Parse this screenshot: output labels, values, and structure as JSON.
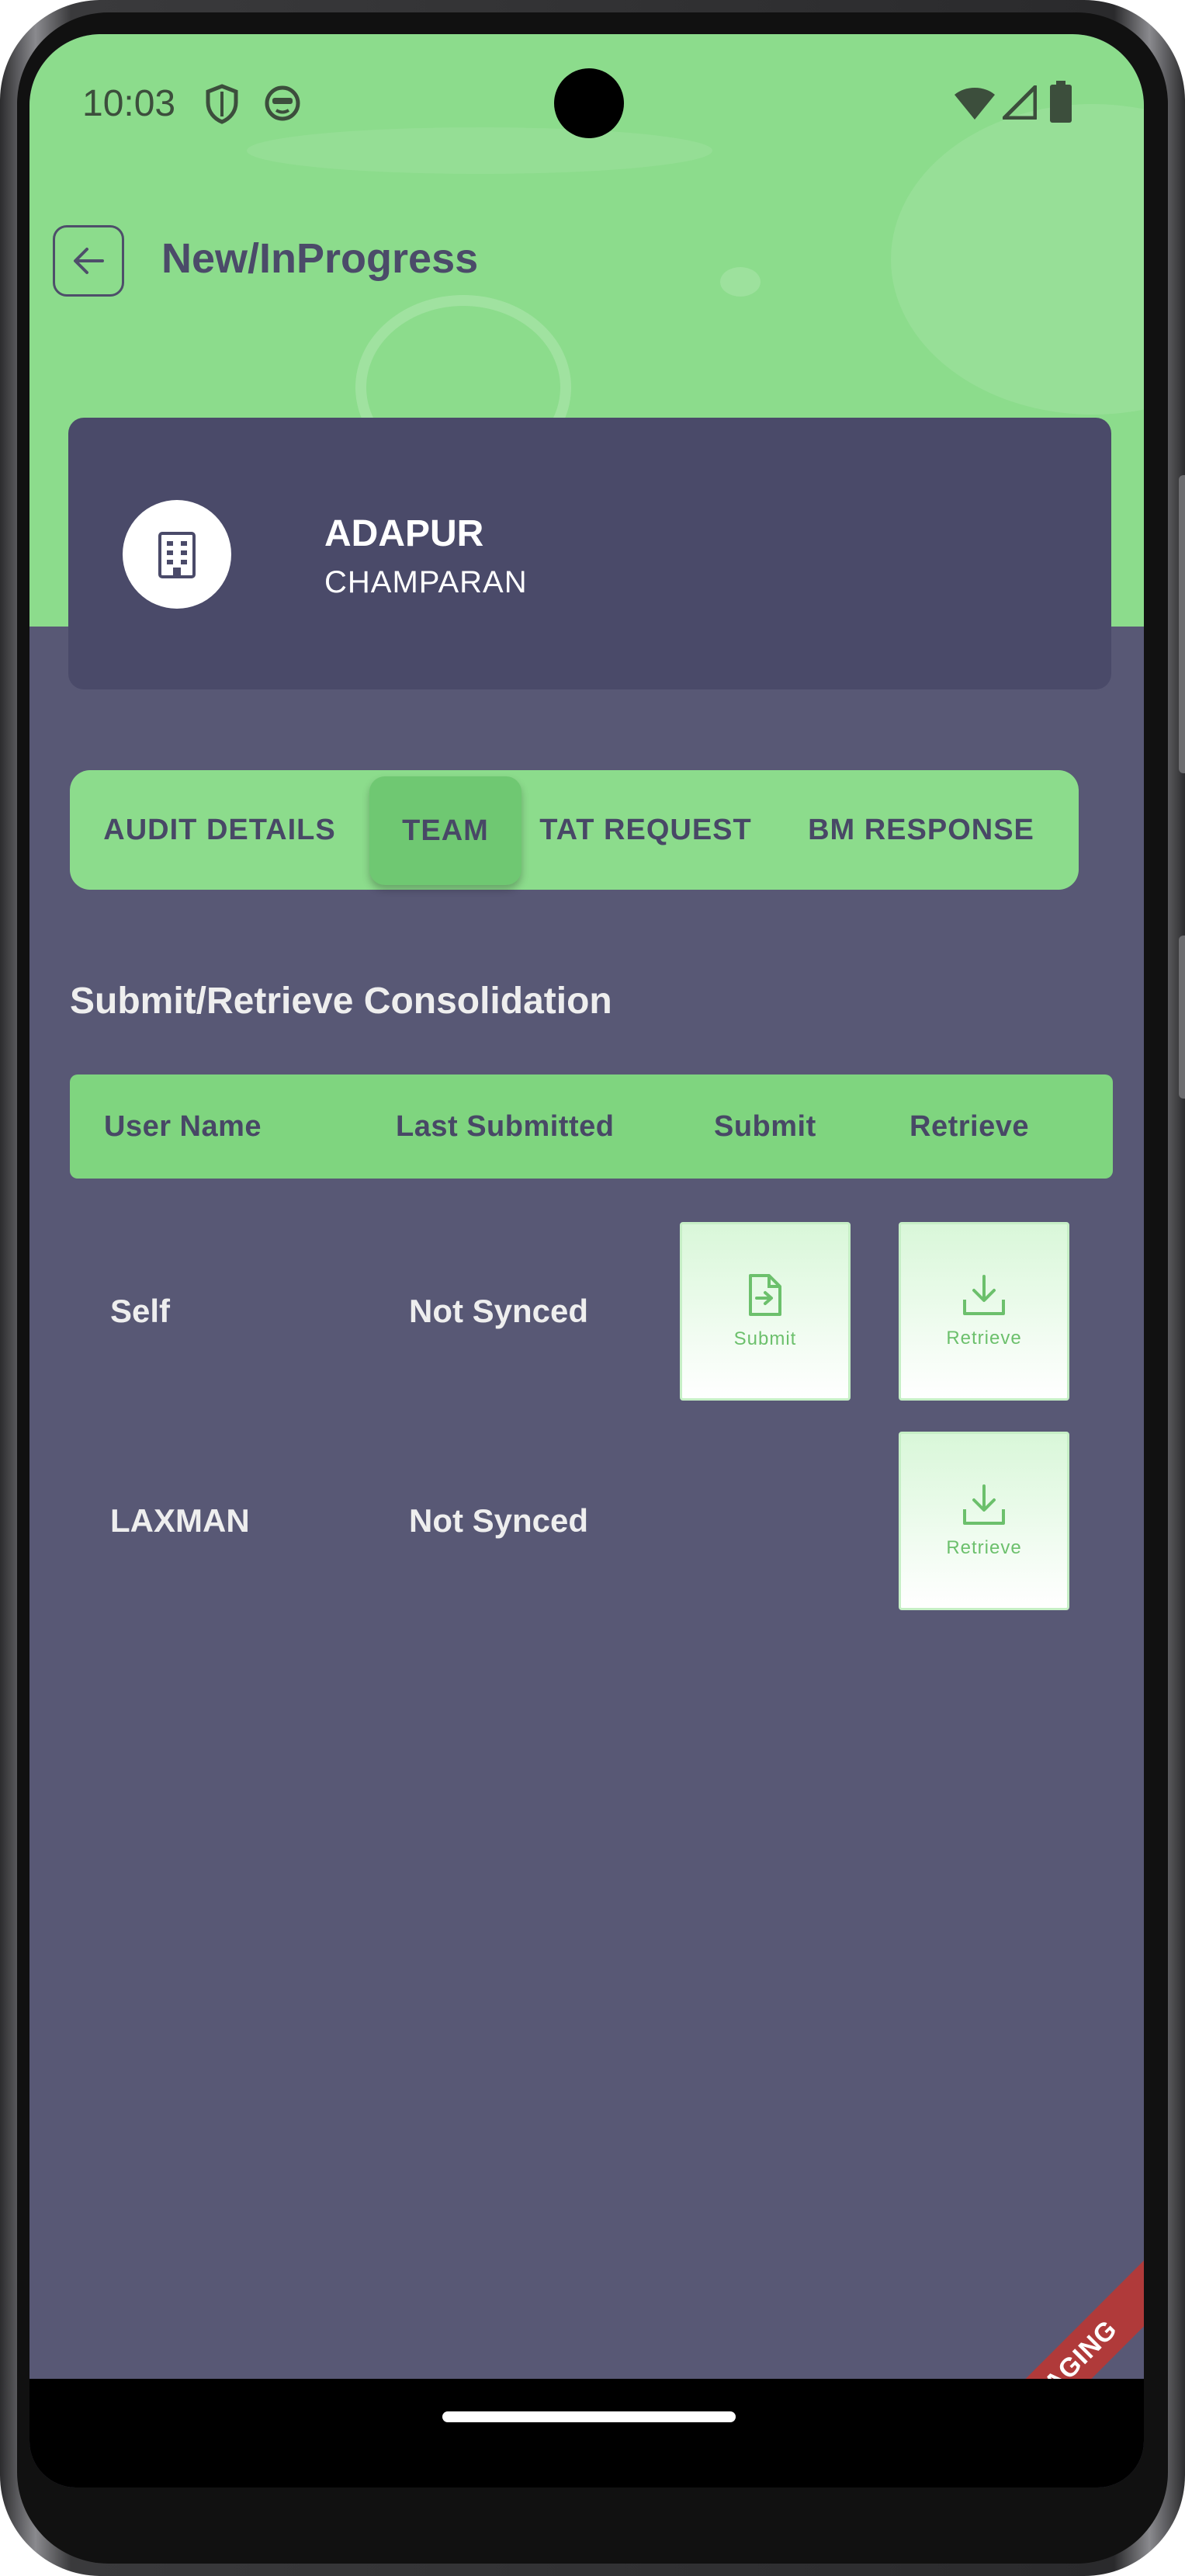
{
  "status_bar": {
    "time": "10:03"
  },
  "header": {
    "title": "New/InProgress"
  },
  "branch": {
    "name": "ADAPUR",
    "region": "CHAMPARAN"
  },
  "tabs": [
    {
      "label": "AUDIT DETAILS",
      "active": false
    },
    {
      "label": "TEAM",
      "active": true
    },
    {
      "label": "TAT REQUEST",
      "active": false
    },
    {
      "label": "BM RESPONSE",
      "active": false
    }
  ],
  "section": {
    "title": "Submit/Retrieve Consolidation"
  },
  "table": {
    "headers": [
      "User Name",
      "Last Submitted",
      "Submit",
      "Retrieve"
    ],
    "rows": [
      {
        "user": "Self",
        "status": "Not Synced",
        "submit_label": "Submit",
        "retrieve_label": "Retrieve"
      },
      {
        "user": "LAXMAN",
        "status": "Not Synced",
        "retrieve_label": "Retrieve"
      }
    ]
  },
  "environment_ribbon": "C-STAGING",
  "colors": {
    "accent_green": "#8cdc8c",
    "card": "#4a4a69",
    "background": "#585875",
    "ribbon": "#b03a3a"
  }
}
